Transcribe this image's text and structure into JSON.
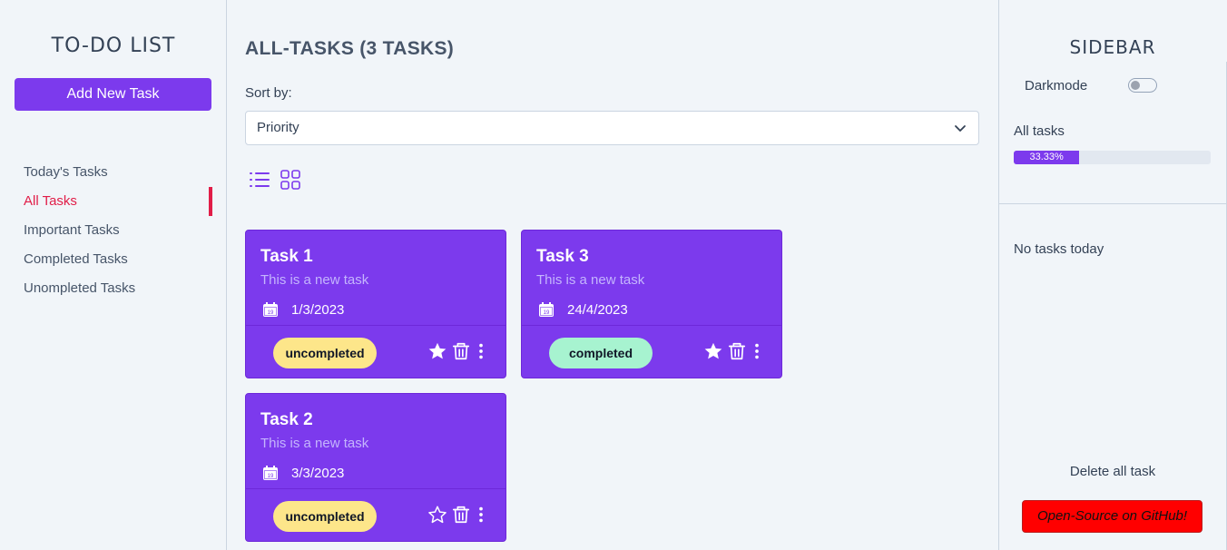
{
  "left": {
    "app_title": "TO-DO LIST",
    "add_button": "Add New Task",
    "nav": [
      {
        "label": "Today's Tasks",
        "active": false
      },
      {
        "label": "All Tasks",
        "active": true
      },
      {
        "label": "Important Tasks",
        "active": false
      },
      {
        "label": "Completed Tasks",
        "active": false
      },
      {
        "label": "Unompleted Tasks",
        "active": false
      }
    ]
  },
  "main": {
    "heading": "ALL-TASKS (3 TASKS)",
    "sort_label": "Sort by:",
    "sort_value": "Priority",
    "view_icons": [
      "list-view-icon",
      "grid-view-icon"
    ],
    "tasks": [
      {
        "title": "Task 1",
        "description": "This is a new task",
        "date": "1/3/2023",
        "status": "uncompleted",
        "important": true
      },
      {
        "title": "Task 3",
        "description": "This is a new task",
        "date": "24/4/2023",
        "status": "completed",
        "important": true
      },
      {
        "title": "Task 2",
        "description": "This is a new task",
        "date": "3/3/2023",
        "status": "uncompleted",
        "important": false
      }
    ]
  },
  "right": {
    "title": "SIDEBAR",
    "darkmode_label": "Darkmode",
    "darkmode_on": false,
    "all_tasks_label": "All tasks",
    "progress_percent": 33.33,
    "progress_text": "33.33%",
    "no_tasks": "No tasks today",
    "delete_all": "Delete all task",
    "github_button": "Open-Source on GitHub!"
  },
  "colors": {
    "accent": "#7c3aed",
    "active_nav": "#e11d48",
    "uncompleted_badge": "#fde68a",
    "completed_badge": "#a7f3d0",
    "github_button": "#ff0000",
    "background": "#f1f5f9"
  }
}
